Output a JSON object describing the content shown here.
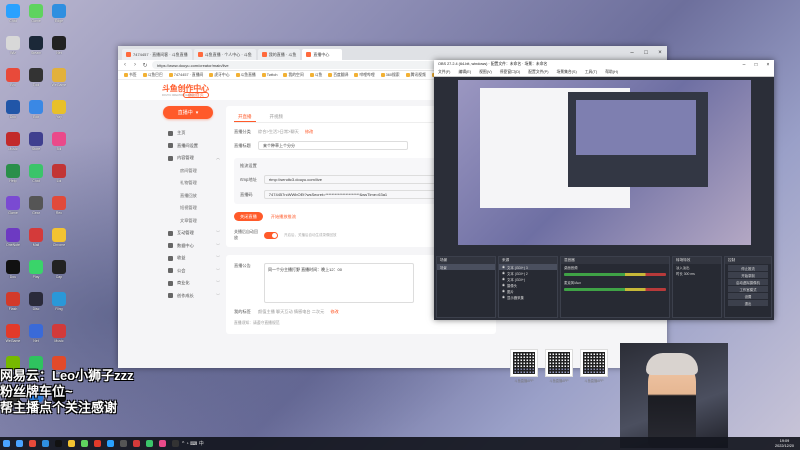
{
  "desktop": {
    "icons": [
      {
        "label": "Chat",
        "color": "#2aa1ff"
      },
      {
        "label": "Game",
        "color": "#5fd35f"
      },
      {
        "label": "Edge",
        "color": "#2f8fe0"
      },
      {
        "label": "Wiz",
        "color": "#d8d8d8"
      },
      {
        "label": "Steam",
        "color": "#1b2838"
      },
      {
        "label": "Net",
        "color": "#222"
      },
      {
        "label": "Bro",
        "color": "#e84a3a"
      },
      {
        "label": "Tool",
        "color": "#333"
      },
      {
        "label": "WeGame",
        "color": "#e2b13c"
      },
      {
        "label": "Doc",
        "color": "#2156a8"
      },
      {
        "label": "Edit",
        "color": "#3a88e5"
      },
      {
        "label": "Yay",
        "color": "#e8c02a"
      },
      {
        "label": "Music",
        "color": "#c22a2a"
      },
      {
        "label": "Store",
        "color": "#3f3f8f"
      },
      {
        "label": "Bili",
        "color": "#ea4a8a"
      },
      {
        "label": "Help",
        "color": "#2a8f4a"
      },
      {
        "label": "Chat",
        "color": "#3bc46a"
      },
      {
        "label": "Lol",
        "color": "#c23535"
      },
      {
        "label": "Game",
        "color": "#7a4ad2"
      },
      {
        "label": "Gear",
        "color": "#555"
      },
      {
        "label": "Rec",
        "color": "#e14a3a"
      },
      {
        "label": "OneNote",
        "color": "#6d3ac2"
      },
      {
        "label": "Mail",
        "color": "#d43a3a"
      },
      {
        "label": "Chrome",
        "color": "#f3c331"
      },
      {
        "label": "Dou",
        "color": "#111"
      },
      {
        "label": "Play",
        "color": "#3ad46a"
      },
      {
        "label": "Cap",
        "color": "#222"
      },
      {
        "label": "Flash",
        "color": "#d23a2a"
      },
      {
        "label": "Disc",
        "color": "#2a2a3a"
      },
      {
        "label": "Ring",
        "color": "#2a98d8"
      },
      {
        "label": "WeGame",
        "color": "#e23a2a"
      },
      {
        "label": "Net",
        "color": "#3a6ad8"
      },
      {
        "label": "Music",
        "color": "#d23a3a"
      },
      {
        "label": "Nvidia",
        "color": "#76b900"
      },
      {
        "label": "WeChat",
        "color": "#2fc35f"
      },
      {
        "label": "Maps",
        "color": "#e24a2a"
      },
      {
        "label": "OBS",
        "color": "#333"
      },
      {
        "label": "Shot",
        "color": "#2a7ad8"
      },
      {
        "label": "TikTok",
        "color": "#111"
      }
    ]
  },
  "browser": {
    "tabs": [
      {
        "label": "7474457 · 直播间客 · 斗鱼直播"
      },
      {
        "label": "斗鱼直播 · 个人中心 · 斗鱼"
      },
      {
        "label": "我的直播 · 斗鱼"
      },
      {
        "label": "直播中心"
      }
    ],
    "url": "https://www.douyu.com/creator/main/live",
    "bookmarks": [
      "书签",
      "斗鱼巴巴",
      "7474457 · 直播间",
      "虎牙中心",
      "斗鱼直播",
      "Twitch",
      "我的空间",
      "斗鱼",
      "百度翻译",
      "哔哩哔哩",
      "360搜索",
      "腾讯视频",
      "虎牙直播",
      "爱奇艺",
      "其他"
    ]
  },
  "site": {
    "logo_title": "斗鱼创作中心",
    "logo_sub": "DOUYU CREATOR CENTER",
    "back_label": "返回首页",
    "live_button": "直播中",
    "menu": [
      {
        "label": "主页",
        "sub": false,
        "chev": ""
      },
      {
        "label": "直播间设置",
        "sub": false,
        "chev": ""
      },
      {
        "label": "内容管理",
        "sub": false,
        "chev": "︿"
      },
      {
        "label": "房间管理",
        "sub": true,
        "chev": ""
      },
      {
        "label": "礼物管理",
        "sub": true,
        "chev": ""
      },
      {
        "label": "直播回放",
        "sub": true,
        "chev": ""
      },
      {
        "label": "短视管理",
        "sub": true,
        "chev": ""
      },
      {
        "label": "文章管理",
        "sub": true,
        "chev": ""
      },
      {
        "label": "互动管理",
        "sub": false,
        "chev": "﹀"
      },
      {
        "label": "数据中心",
        "sub": false,
        "chev": "﹀"
      },
      {
        "label": "收益",
        "sub": false,
        "chev": "﹀"
      },
      {
        "label": "公会",
        "sub": false,
        "chev": "﹀"
      },
      {
        "label": "商业化",
        "sub": false,
        "chev": "﹀"
      },
      {
        "label": "创作成长",
        "sub": false,
        "chev": "﹀"
      }
    ],
    "tabs": {
      "active": "开直播",
      "inactive": "开视频"
    },
    "category_key": "直播分类",
    "category_value": "综合>生活>日常>聊天",
    "category_link": "修改",
    "title_key": "直播标题",
    "title_value": "来个种草上个分分",
    "addr_title": "推流设置",
    "rtmp_key": "rtmp地址",
    "rtmp_value": "rtmp://sendtc3.douyu.com/live",
    "code_key": "直播码",
    "code_value": "7474457rcWWbOEt?wsSecret=**********************&wsTime=63a1",
    "stop_label": "关闭直播",
    "ghost_label": "开始播放推流",
    "toggle_key": "关播后自动回放",
    "toggle_hint": "开启后，关播后自动生成录像回放",
    "notice_key": "直播公告",
    "notice_value": "同一个分主播打野 直播时间：晚上12：00",
    "tags_key": "我的标签",
    "tags_value": "颜值主播  聊天互动  情感电台  二次元",
    "tags_link": "修改",
    "foot_note": "直播须知：请遵守直播规范",
    "qr_codes": [
      "斗鱼直播APP",
      "斗鱼直播APP",
      "斗鱼直播APP"
    ]
  },
  "obs": {
    "title": "OBS 27.2.4 (64-bit, windows) · 配置文件：未命名 · 场景：未命名",
    "menu": [
      "文件(F)",
      "编辑(E)",
      "视图(V)",
      "停靠窗口(D)",
      "配置文件(P)",
      "场景集合(S)",
      "工具(T)",
      "帮助(H)"
    ],
    "docks": {
      "scenes": {
        "title": "场景",
        "items": [
          "场景"
        ]
      },
      "sources": {
        "title": "来源",
        "items": [
          "文本 (GDI+) 3",
          "文本 (GDI+) 2",
          "文本 (GDI+)",
          "摄像头",
          "图片",
          "显示器采集"
        ]
      },
      "mixer": {
        "title": "混音器",
        "items": [
          "桌面音频",
          "麦克风/Aux"
        ]
      },
      "transitions": {
        "title": "转场特效",
        "items": [
          "淡入淡出",
          "时长 300 ms"
        ]
      },
      "controls": {
        "title": "控制",
        "items": [
          "停止推流",
          "开始录制",
          "启动虚拟摄像机",
          "工作室模式",
          "设置",
          "退出"
        ]
      }
    }
  },
  "overlay": {
    "line1": "网易云：Leo小狮子zzz",
    "line2": "粉丝牌车位~",
    "line3": "帮主播点个关注感谢"
  },
  "taskbar": {
    "icons": [
      "#4aa3ff",
      "#e84a3a",
      "#2f8fe0",
      "#111",
      "#f3c331",
      "#5fd35f",
      "#e23a2a",
      "#2aa1ff",
      "#555",
      "#d43a3a",
      "#3bc46a",
      "#ea4a8a",
      "#333"
    ],
    "time": "19:09",
    "date": "2022/12/20",
    "tray": "^ ◔ ⌨ 中"
  }
}
